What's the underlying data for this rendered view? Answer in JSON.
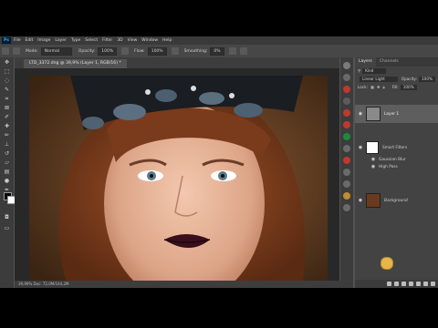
{
  "menu": {
    "logo": "Ps",
    "items": [
      "File",
      "Edit",
      "Image",
      "Layer",
      "Type",
      "Select",
      "Filter",
      "3D",
      "View",
      "Window",
      "Help"
    ]
  },
  "options": {
    "mode_label": "Mode:",
    "mode_value": "Normal",
    "opacity_label": "Opacity:",
    "opacity_value": "100%",
    "flow_label": "Flow:",
    "flow_value": "100%",
    "smoothing_label": "Smoothing:",
    "smoothing_value": "0%"
  },
  "document": {
    "tab_title": "LTD_3372.dng @ 39,9% (Layer 1, RGB/16) *",
    "status": "39,99%   Doc: 72,0M/144,2M"
  },
  "layers_panel": {
    "tabs": [
      "Layers",
      "Channels"
    ],
    "kind_label": "Kind",
    "blend_mode": "Linear Light",
    "opacity_label": "Opacity:",
    "opacity_value": "100%",
    "lock_label": "Lock:",
    "fill_label": "Fill:",
    "fill_value": "100%",
    "layers": [
      {
        "name": "Layer 1",
        "selected": true
      },
      {
        "name": "Smart Filters",
        "selected": false
      },
      {
        "name": "Gaussian Blur",
        "selected": false
      },
      {
        "name": "High Pass",
        "selected": false
      },
      {
        "name": "Background",
        "selected": false
      }
    ]
  },
  "colors": {
    "ui_dark": "#3c3c3c",
    "panel": "#434343",
    "selected_layer": "#5e5e5e",
    "accent_red": "#c0392b",
    "cursor": "#e8b54a"
  },
  "icons": [
    "move-icon",
    "marquee-icon",
    "lasso-icon",
    "crop-icon",
    "eyedropper-icon",
    "brush-icon",
    "stamp-icon",
    "eraser-icon",
    "gradient-icon",
    "dodge-icon",
    "pen-icon",
    "type-icon",
    "path-select-icon",
    "shape-icon",
    "hand-icon",
    "zoom-icon"
  ]
}
